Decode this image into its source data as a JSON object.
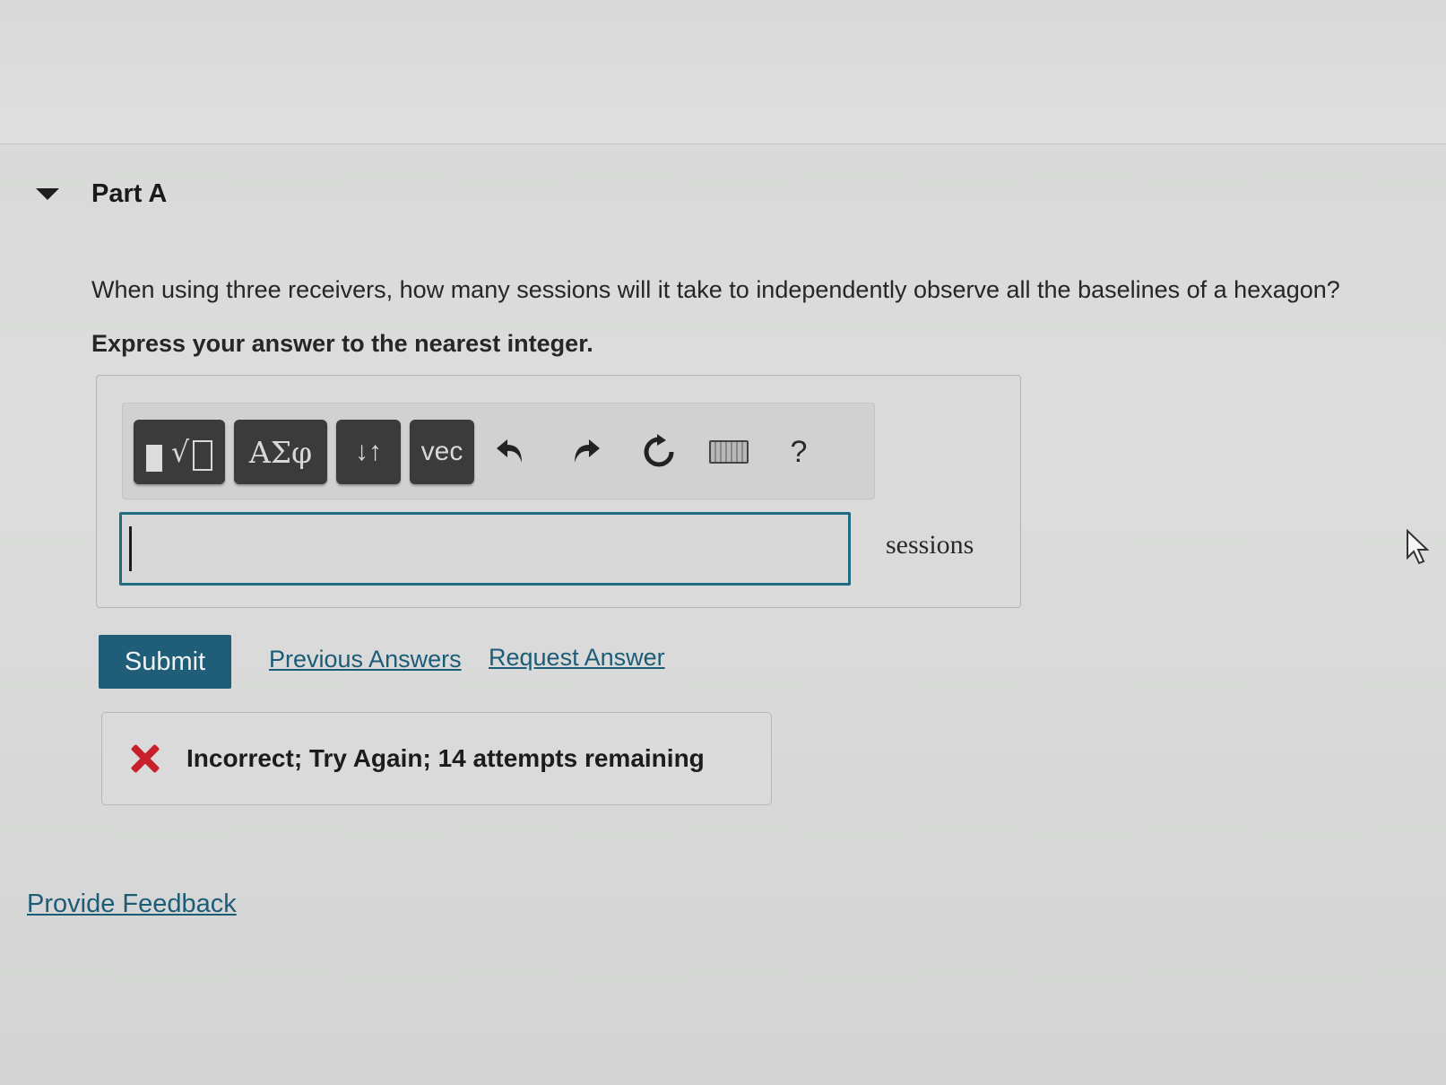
{
  "part": {
    "title": "Part A"
  },
  "question": {
    "text": "When using three receivers, how many sessions will it take to independently observe all the baselines of a hexagon?",
    "instruction": "Express your answer to the nearest integer."
  },
  "toolbar": {
    "templates_icon": "templates-sqrt-icon",
    "greek_label": "ΑΣφ",
    "updown_label": "↓↑",
    "vec_label": "vec",
    "undo_icon": "undo-icon",
    "redo_icon": "redo-icon",
    "reset_icon": "reset-icon",
    "keyboard_icon": "keyboard-icon",
    "help_label": "?"
  },
  "answer": {
    "value": "",
    "unit": "sessions"
  },
  "actions": {
    "submit_label": "Submit",
    "previous_answers_label": "Previous Answers",
    "request_answer_label": "Request Answer"
  },
  "feedback": {
    "status_icon": "incorrect-x-icon",
    "message": "Incorrect; Try Again; 14 attempts remaining",
    "status_color": "#c8202a"
  },
  "footer": {
    "provide_feedback_label": "Provide Feedback"
  },
  "colors": {
    "accent": "#1f5d78",
    "input_border": "#1f6b82",
    "toolbar_button": "#3b3b3b"
  }
}
